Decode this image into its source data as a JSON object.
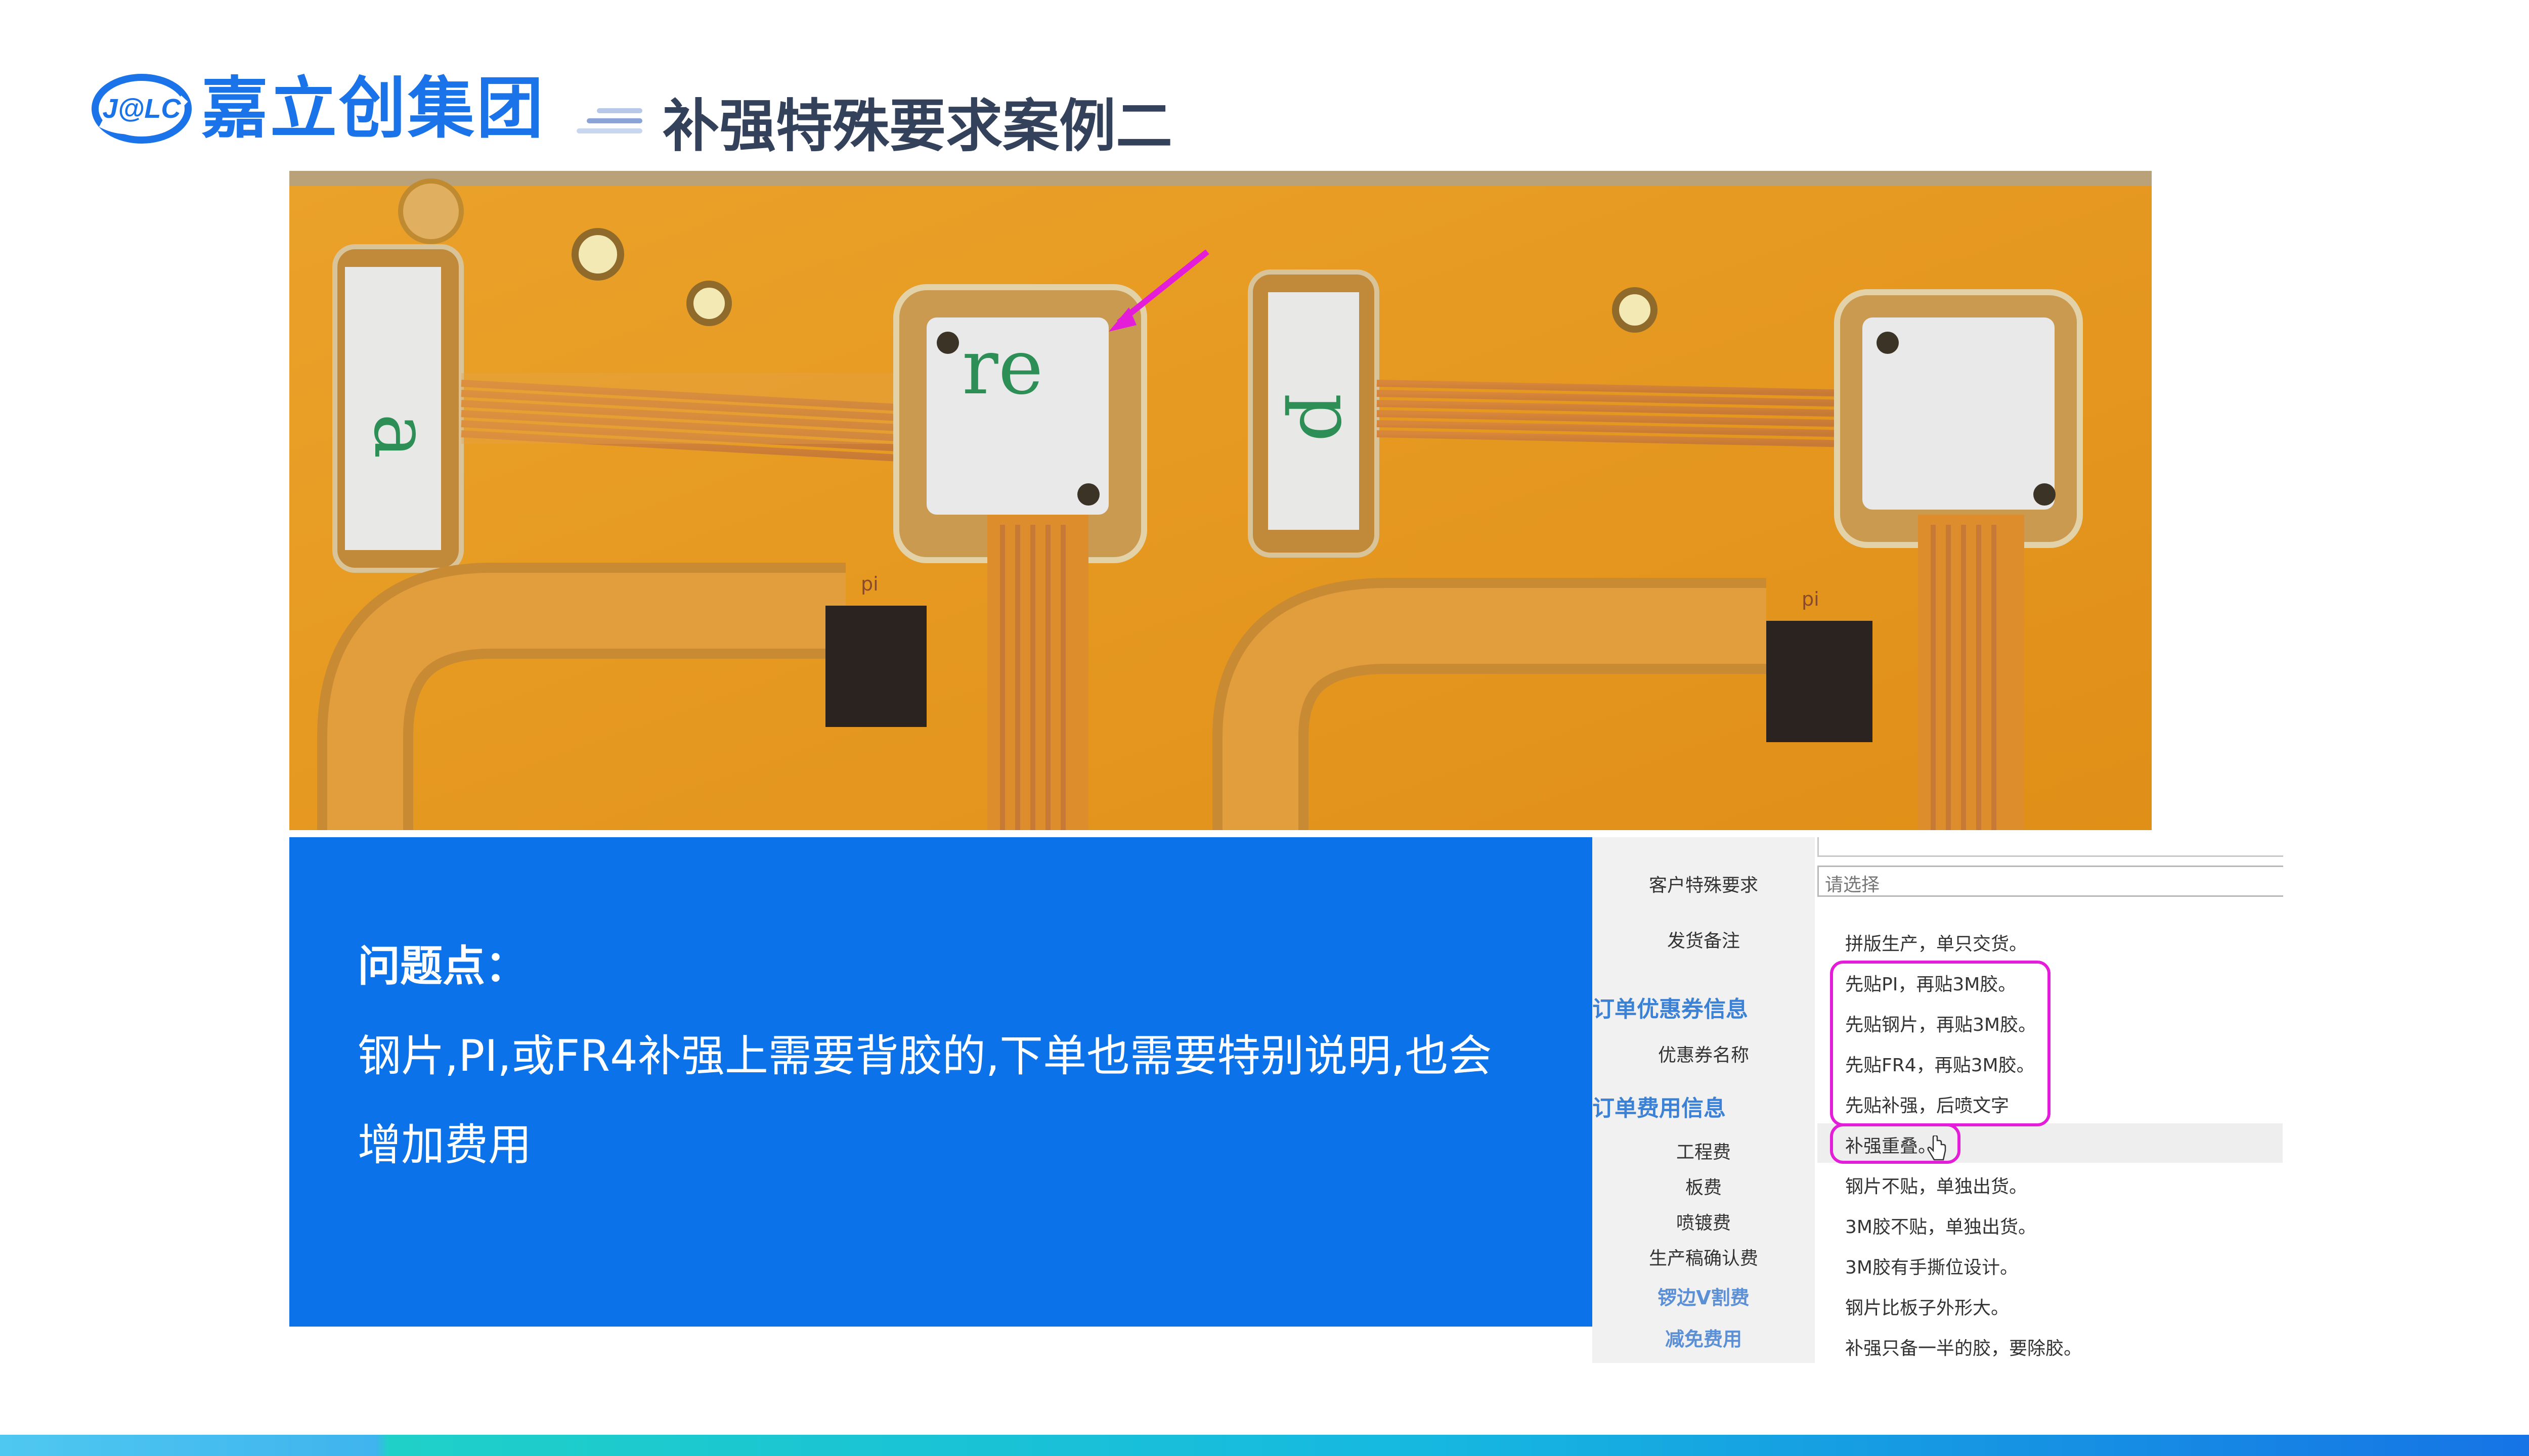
{
  "brand": {
    "logo_mark": "J@LC",
    "name": "嘉立创集团"
  },
  "slide": {
    "title": "补强特殊要求案例二"
  },
  "problem": {
    "heading": "问题点：",
    "body": "钢片,PI,或FR4补强上需要背胶的,下单也需要特别说明,也会增加费用"
  },
  "form": {
    "rows": [
      {
        "label": "客户特殊要求"
      },
      {
        "label": "发货备注"
      }
    ],
    "select_placeholder": "请选择",
    "sections": [
      {
        "title": "订单优惠券信息"
      },
      {
        "title": "订单费用信息"
      }
    ],
    "coupon_label": "优惠券名称",
    "fee_labels": [
      "工程费",
      "板费",
      "喷镀费",
      "生产稿确认费"
    ],
    "link_labels": [
      "锣边V割费",
      "减免费用"
    ],
    "options": [
      "拼版生产，单只交货。",
      "先贴PI，再贴3M胶。",
      "先贴钢片，再贴3M胶。",
      "先贴FR4，再贴3M胶。",
      "先贴补强，后喷文字",
      "补强重叠。",
      "钢片不贴，单独出货。",
      "3M胶不贴，单独出货。",
      "3M胶有手撕位设计。",
      "钢片比板子外形大。",
      "补强只备一半的胶，要除胶。"
    ]
  },
  "photo": {
    "pad_label": "pi",
    "stiffener_text": "re"
  },
  "colors": {
    "brand_blue": "#1a73e8",
    "panel_blue": "#0c72ea",
    "title_gray": "#34415a",
    "highlight_magenta": "#e41dd8",
    "fpc_orange": "#e89a1e"
  }
}
